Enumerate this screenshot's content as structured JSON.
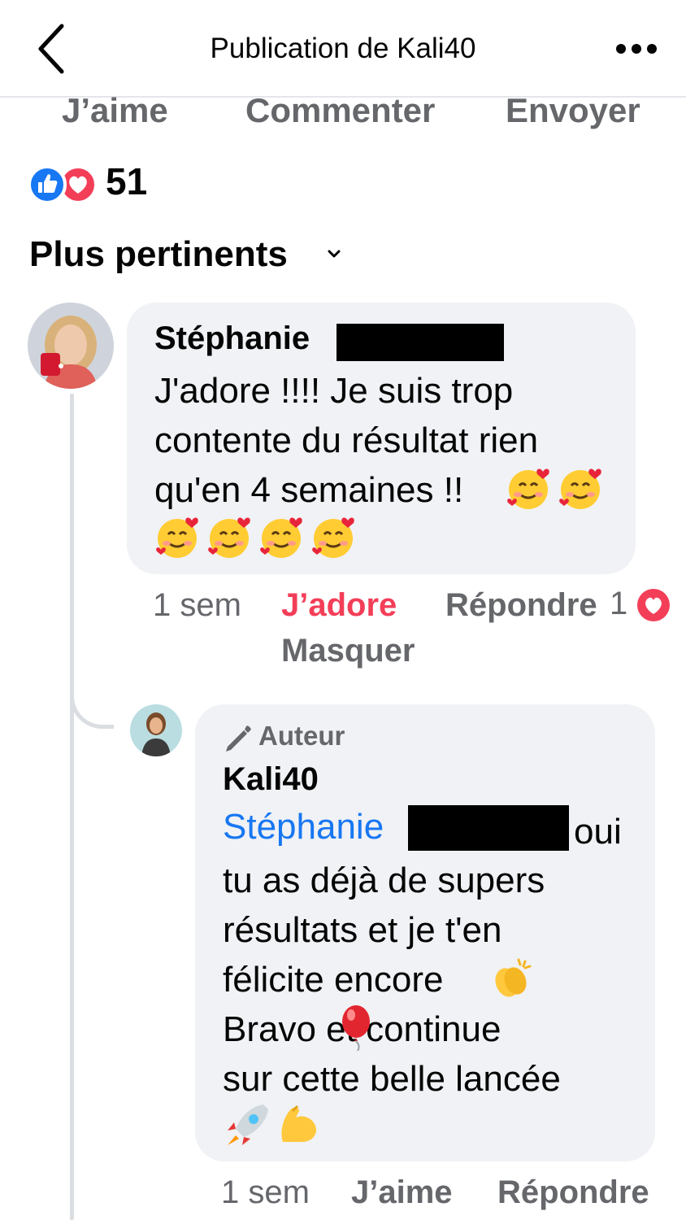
{
  "header": {
    "title": "Publication de Kali40"
  },
  "actions": {
    "like": "J’aime",
    "comment": "Commenter",
    "send": "Envoyer"
  },
  "reactions": {
    "count": "51",
    "types": [
      "like",
      "love"
    ]
  },
  "sort": {
    "label": "Plus pertinents"
  },
  "comment1": {
    "author": "Stéphanie",
    "text": "J'adore !!!! Je suis trop\ncontente du résultat rien\nqu'en 4 semaines !!",
    "time": "1 sem",
    "reaction_label": "J’adore",
    "reply_label": "Répondre",
    "reaction_count": "1",
    "hide_label": "Masquer"
  },
  "comment2": {
    "badge": "Auteur",
    "author": "Kali40",
    "mention": "Stéphanie",
    "text_after_mention": "oui",
    "text": "tu as déjà de supers\nrésultats et je t'en\nfélicite encore\nBravo       et continue\nsur cette belle lancée",
    "time": "1 sem",
    "like_label": "J’aime",
    "reply_label": "Répondre"
  },
  "colors": {
    "meta_gray": "#65676b",
    "love_red": "#f33e58",
    "mention_blue": "#1877f2",
    "bubble_bg": "#f0f2f5"
  },
  "icons": [
    "chevron-left-icon",
    "more-icon",
    "like-reaction-icon",
    "love-reaction-icon",
    "chevron-down-icon",
    "pencil-icon",
    "smiling-face-with-hearts-emoji",
    "clapping-hands-emoji",
    "balloon-emoji",
    "rocket-emoji",
    "flexed-biceps-emoji"
  ]
}
